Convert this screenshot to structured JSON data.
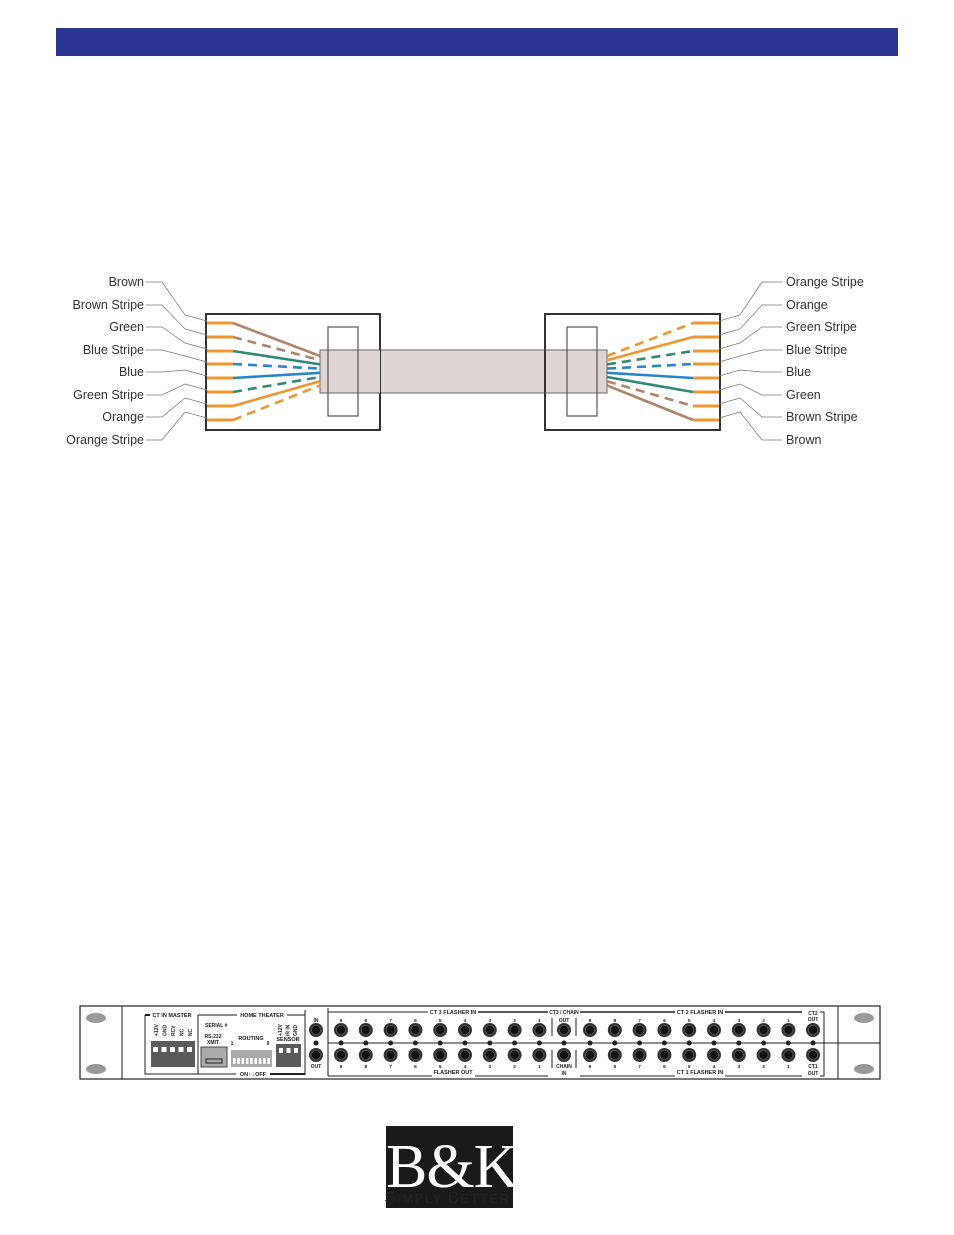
{
  "header": {
    "color": "#2b3593"
  },
  "cable_diagram": {
    "left_connector": {
      "labels": [
        "Brown",
        "Brown Stripe",
        "Green",
        "Blue Stripe",
        "Blue",
        "Green Stripe",
        "Orange",
        "Orange Stripe"
      ],
      "wires": [
        {
          "color": "#b08468",
          "style": "solid"
        },
        {
          "color": "#b08468",
          "style": "dashed"
        },
        {
          "color": "#2e8a74",
          "style": "solid"
        },
        {
          "color": "#2a84c8",
          "style": "dashed"
        },
        {
          "color": "#2a84c8",
          "style": "solid"
        },
        {
          "color": "#2e8a74",
          "style": "dashed"
        },
        {
          "color": "#f0962e",
          "style": "solid"
        },
        {
          "color": "#f0962e",
          "style": "dashed"
        }
      ]
    },
    "right_connector": {
      "labels": [
        "Orange Stripe",
        "Orange",
        "Green Stripe",
        "Blue Stripe",
        "Blue",
        "Green",
        "Brown Stripe",
        "Brown"
      ],
      "wires": [
        {
          "color": "#f0962e",
          "style": "dashed"
        },
        {
          "color": "#f0962e",
          "style": "solid"
        },
        {
          "color": "#2e8a74",
          "style": "dashed"
        },
        {
          "color": "#2a84c8",
          "style": "dashed"
        },
        {
          "color": "#2a84c8",
          "style": "solid"
        },
        {
          "color": "#2e8a74",
          "style": "solid"
        },
        {
          "color": "#b08468",
          "style": "dashed"
        },
        {
          "color": "#b08468",
          "style": "solid"
        }
      ]
    },
    "pin_color": "#f0962e",
    "cable_color": "#ddd6d3"
  },
  "rear_panel": {
    "ct_in_master": {
      "title": "CT IN MASTER",
      "pins": [
        "+12V",
        "GND",
        "RCV",
        "NC",
        "NC"
      ]
    },
    "home_theater": {
      "title": "HOME THEATER",
      "serial": "SERIAL #",
      "rs232": "RS-232",
      "xmit": "XMIT",
      "routing": "ROUTING",
      "routing_start": "1",
      "routing_end": "9",
      "on_off": "ON↑ ↓OFF"
    },
    "sensor": {
      "title": "SENSOR",
      "pins": [
        "+12V",
        "IR IN",
        "GND"
      ]
    },
    "ir": {
      "in": "IN",
      "out": "OUT"
    },
    "ct3_flasher_in": "CT 3 FLASHER IN",
    "flasher_out": "FLASHER OUT",
    "ct3_chain": "CT3 / CHAIN",
    "chain_out": "OUT",
    "chain_in": [
      "CHAIN",
      "IN"
    ],
    "ct2_flasher_in": "CT 2 FLASHER IN",
    "ct1_flasher_in": "CT 1 FLASHER IN",
    "ct2_out": [
      "CT2",
      "OUT"
    ],
    "ct1_out": [
      "CT1",
      "OUT"
    ],
    "jack_numbers": [
      "9",
      "8",
      "7",
      "6",
      "5",
      "4",
      "3",
      "2",
      "1"
    ]
  },
  "logo": {
    "text": "B&K",
    "tagline_parts": [
      "S",
      "IMPLY ",
      "B",
      "ETTER!"
    ]
  }
}
